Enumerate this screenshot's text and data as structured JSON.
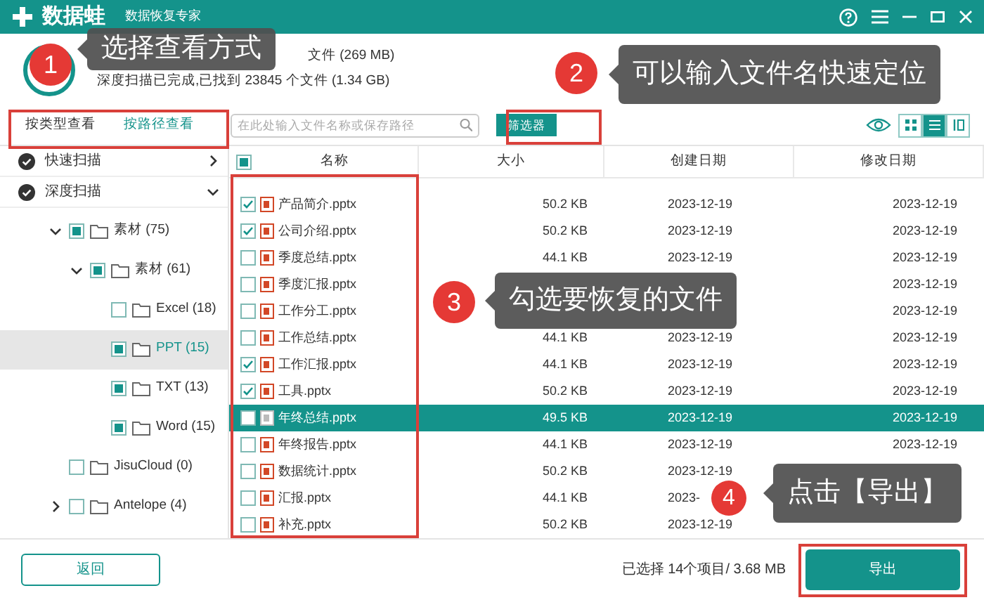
{
  "app": {
    "name": "数据蛙",
    "subtitle": "数据恢复专家"
  },
  "scan_summary": [
    "文件 (269 MB)",
    "深度扫描已完成,已找到 23845 个文件 (1.34 GB)"
  ],
  "view_tabs": [
    {
      "label": "按类型查看",
      "selected": false
    },
    {
      "label": "按路径查看",
      "selected": true
    }
  ],
  "search": {
    "placeholder": "在此处输入文件名称或保存路径"
  },
  "filter_button": "筛选器",
  "view_modes": [
    {
      "kind": "grid",
      "selected": false
    },
    {
      "kind": "list",
      "selected": true
    },
    {
      "kind": "columns",
      "selected": false
    }
  ],
  "scans": [
    {
      "label": "快速扫描",
      "expanded": false
    },
    {
      "label": "深度扫描",
      "expanded": true
    }
  ],
  "tree": [
    {
      "label": "素材 (75)",
      "expanded": true,
      "checked": false,
      "partial": true,
      "selected": false,
      "children": [
        {
          "label": "素材 (61)",
          "expanded": true,
          "checked": false,
          "partial": true,
          "selected": false,
          "children": [
            {
              "label": "Excel (18)",
              "checked": false,
              "partial": false,
              "selected": false
            },
            {
              "label": "PPT (15)",
              "checked": false,
              "partial": true,
              "selected": true
            },
            {
              "label": "TXT (13)",
              "checked": false,
              "partial": true,
              "selected": false
            },
            {
              "label": "Word (15)",
              "checked": false,
              "partial": true,
              "selected": false
            }
          ]
        }
      ]
    },
    {
      "label": "JisuCloud (0)",
      "checked": false,
      "partial": false,
      "selected": false
    },
    {
      "label": "Antelope (4)",
      "expanded": false,
      "checked": false,
      "partial": false,
      "selected": false
    }
  ],
  "table": {
    "header_checked": false,
    "header_partial": true,
    "columns": [
      "名称",
      "大小",
      "创建日期",
      "修改日期"
    ],
    "rows": [
      {
        "name": "产品简介.pptx",
        "size": "50.2 KB",
        "created": "2023-12-19",
        "modified": "2023-12-19",
        "checked": true,
        "selected": false
      },
      {
        "name": "公司介绍.pptx",
        "size": "50.2 KB",
        "created": "2023-12-19",
        "modified": "2023-12-19",
        "checked": true,
        "selected": false
      },
      {
        "name": "季度总结.pptx",
        "size": "44.1 KB",
        "created": "2023-12-19",
        "modified": "2023-12-19",
        "checked": false,
        "selected": false
      },
      {
        "name": "季度汇报.pptx",
        "modified": "2023-12-19",
        "checked": false,
        "selected": false
      },
      {
        "name": "工作分工.pptx",
        "modified": "2023-12-19",
        "checked": false,
        "selected": false
      },
      {
        "name": "工作总结.pptx",
        "size": "44.1 KB",
        "created": "2023-12-19",
        "modified": "2023-12-19",
        "checked": false,
        "selected": false
      },
      {
        "name": "工作汇报.pptx",
        "size": "44.1 KB",
        "created": "2023-12-19",
        "modified": "2023-12-19",
        "checked": true,
        "selected": false
      },
      {
        "name": "工具.pptx",
        "size": "50.2 KB",
        "created": "2023-12-19",
        "modified": "2023-12-19",
        "checked": true,
        "selected": false
      },
      {
        "name": "年终总结.pptx",
        "size": "49.5 KB",
        "created": "2023-12-19",
        "modified": "2023-12-19",
        "checked": false,
        "selected": true
      },
      {
        "name": "年终报告.pptx",
        "size": "44.1 KB",
        "created": "2023-12-19",
        "modified": "2023-12-19",
        "checked": false,
        "selected": false
      },
      {
        "name": "数据统计.pptx",
        "size": "50.2 KB",
        "created": "2023-12-19",
        "checked": false,
        "selected": false
      },
      {
        "name": "汇报.pptx",
        "size": "44.1 KB",
        "created": "2023-",
        "checked": false,
        "selected": false
      },
      {
        "name": "补充.pptx",
        "size": "50.2 KB",
        "created": "2023-12-19",
        "checked": false,
        "selected": false
      }
    ]
  },
  "footer": {
    "back_button": "返回",
    "selection": "已选择 14个项目/ 3.68 MB",
    "export_button": "导出"
  },
  "callouts": [
    {
      "number": "1",
      "text": "选择查看方式"
    },
    {
      "number": "2",
      "text": "可以输入文件名快速定位"
    },
    {
      "number": "3",
      "text": "勾选要恢复的文件"
    },
    {
      "number": "4",
      "text": "点击【导出】"
    }
  ]
}
